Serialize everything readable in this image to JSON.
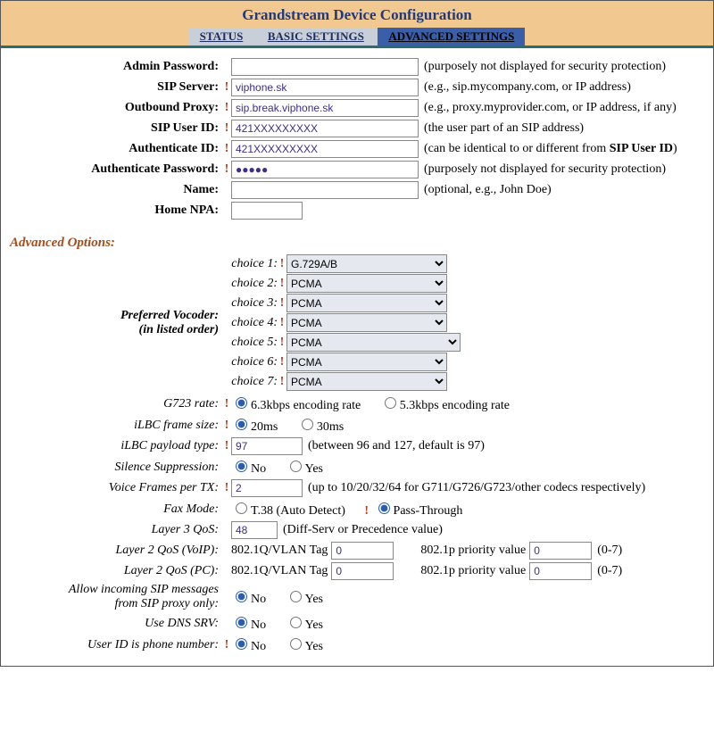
{
  "header": {
    "title": "Grandstream Device Configuration"
  },
  "nav": {
    "status": "STATUS",
    "basic": "BASIC SETTINGS",
    "advanced": "ADVANCED SETTINGS"
  },
  "labels": {
    "admin_password": "Admin Password:",
    "sip_server": "SIP Server:",
    "outbound_proxy": "Outbound Proxy:",
    "sip_user_id": "SIP User ID:",
    "authenticate_id": "Authenticate ID:",
    "authenticate_password": "Authenticate Password:",
    "name": "Name:",
    "home_npa": "Home NPA:",
    "advanced_options": "Advanced Options:",
    "preferred_vocoder": "Preferred Vocoder:",
    "in_listed_order": "(in listed order)",
    "g723_rate": "G723 rate:",
    "ilbc_frame_size": "iLBC frame size:",
    "ilbc_payload_type": "iLBC payload type:",
    "silence_suppression": "Silence Suppression:",
    "voice_frames_per_tx": "Voice Frames per TX:",
    "fax_mode": "Fax Mode:",
    "layer3_qos": "Layer 3 QoS:",
    "layer2_qos_voip": "Layer 2 QoS (VoIP):",
    "layer2_qos_pc": "Layer 2 QoS (PC):",
    "allow_incoming_sip_1": "Allow incoming SIP messages",
    "allow_incoming_sip_2": "from SIP proxy only:",
    "use_dns_srv": "Use DNS SRV:",
    "user_id_is_phone": "User ID is phone number:"
  },
  "hints": {
    "admin_password": "(purposely not displayed for security protection)",
    "sip_server": "(e.g., sip.mycompany.com, or IP address)",
    "outbound_proxy": "(e.g., proxy.myprovider.com, or IP address, if any)",
    "sip_user_id": "(the user part of an SIP address)",
    "authenticate_id_a": "(can be identical to or different from ",
    "authenticate_id_b": "SIP User ID",
    "authenticate_id_c": ")",
    "authenticate_password": "(purposely not displayed for security protection)",
    "name": "(optional, e.g., John Doe)",
    "ilbc_payload": "(between 96 and 127, default is 97)",
    "voice_frames": "(up to 10/20/32/64 for G711/G726/G723/other codecs respectively)",
    "layer3": "(Diff-Serv or Precedence value)",
    "vlan_tag": "802.1Q/VLAN Tag",
    "priority_value": "802.1p priority value",
    "range07": "(0-7)"
  },
  "values": {
    "admin_password": "",
    "sip_server": "viphone.sk",
    "outbound_proxy": "sip.break.viphone.sk",
    "sip_user_id": "421XXXXXXXXX",
    "authenticate_id": "421XXXXXXXXX",
    "authenticate_password": "●●●●●",
    "name": "",
    "home_npa": "",
    "ilbc_payload": "97",
    "voice_frames": "2",
    "layer3": "48",
    "l2_voip_tag": "0",
    "l2_voip_pri": "0",
    "l2_pc_tag": "0",
    "l2_pc_pri": "0"
  },
  "choices": {
    "c1_label": "choice 1:",
    "c1_value": "G.729A/B",
    "c2_label": "choice 2:",
    "c2_value": "PCMA",
    "c3_label": "choice 3:",
    "c3_value": "PCMA",
    "c4_label": "choice 4:",
    "c4_value": "PCMA",
    "c5_label": "choice 5:",
    "c5_value": "PCMA",
    "c6_label": "choice 6:",
    "c6_value": "PCMA",
    "c7_label": "choice 7:",
    "c7_value": "PCMA"
  },
  "radios": {
    "g723_a": "6.3kbps encoding rate",
    "g723_b": "5.3kbps encoding rate",
    "ilbc_a": "20ms",
    "ilbc_b": "30ms",
    "no": "No",
    "yes": "Yes",
    "fax_a": "T.38 (Auto Detect)",
    "fax_b": "Pass-Through"
  }
}
